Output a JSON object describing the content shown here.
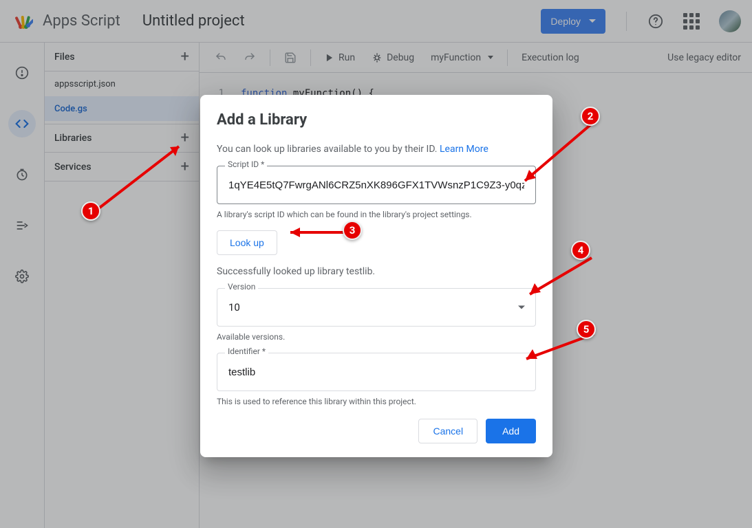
{
  "header": {
    "brand": "Apps Script",
    "project_title": "Untitled project",
    "deploy_label": "Deploy"
  },
  "sidebar": {
    "files_title": "Files",
    "libraries_title": "Libraries",
    "services_title": "Services",
    "file_manifest": "appsscript.json",
    "file_code": "Code.gs"
  },
  "toolbar": {
    "run": "Run",
    "debug": "Debug",
    "func": "myFunction",
    "exec_log": "Execution log",
    "legacy": "Use legacy editor"
  },
  "editor": {
    "line1_num": "1",
    "line1_kw": "function",
    "line1_rest": " myFunction() {"
  },
  "dialog": {
    "title": "Add a Library",
    "desc": "You can look up libraries available to you by their ID. ",
    "learn_more": "Learn More",
    "script_id_label": "Script ID *",
    "script_id_value": "1qYE4E5tQ7FwrgANl6CRZ5nXK896GFX1TVWsnzP1C9Z3-y0qz",
    "script_id_helper": "A library's script ID which can be found in the library's project settings.",
    "lookup": "Look up",
    "lookup_success": "Successfully looked up library testlib.",
    "version_label": "Version",
    "version_value": "10",
    "version_helper": "Available versions.",
    "identifier_label": "Identifier *",
    "identifier_value": "testlib",
    "identifier_helper": "This is used to reference this library within this project.",
    "cancel": "Cancel",
    "add": "Add"
  },
  "annotations": {
    "b1": "1",
    "b2": "2",
    "b3": "3",
    "b4": "4",
    "b5": "5"
  }
}
